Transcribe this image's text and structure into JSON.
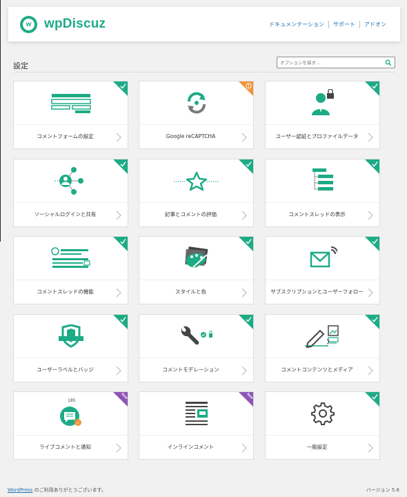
{
  "brand": {
    "name": "wpDiscuz",
    "logo_letter": "w"
  },
  "top_nav": [
    "ドキュメンテーション",
    "サポート",
    "アドオン"
  ],
  "page": {
    "title": "設定",
    "search_placeholder": "オプションを探す..."
  },
  "colors": {
    "accent": "#1dab86",
    "warning": "#f0953a",
    "new": "#8e55b5"
  },
  "cards": [
    {
      "label": "コメントフォームの設定",
      "icon": "comment-form-icon",
      "badge": "check"
    },
    {
      "label": "Google reCAPTCHA",
      "icon": "recaptcha-icon",
      "badge": "warning"
    },
    {
      "label": "ユーザー認証とプロファイルデータ",
      "icon": "user-auth-icon",
      "badge": "check"
    },
    {
      "label": "ソーシャルログインと共有",
      "icon": "social-share-icon",
      "badge": "check"
    },
    {
      "label": "記事とコメントの評価",
      "icon": "star-rating-icon",
      "badge": "check"
    },
    {
      "label": "コメントスレッドの表示",
      "icon": "thread-display-icon",
      "badge": "check"
    },
    {
      "label": "コメントスレッドの機能",
      "icon": "thread-features-icon",
      "badge": "check"
    },
    {
      "label": "スタイルと色",
      "icon": "palette-icon",
      "badge": "check"
    },
    {
      "label": "サブスクリプションとユーザーフォロー",
      "icon": "subscription-icon",
      "badge": "check"
    },
    {
      "label": "ユーザーラベルとバッジ",
      "icon": "badge-shield-icon",
      "badge": "check"
    },
    {
      "label": "コメントモデレーション",
      "icon": "moderation-wrench-icon",
      "badge": "check"
    },
    {
      "label": "コメントコンテンツとメディア",
      "icon": "content-media-icon",
      "badge": "check"
    },
    {
      "label": "ライブコメントと通知",
      "icon": "live-notification-icon",
      "badge": "new",
      "counter": "185"
    },
    {
      "label": "インラインコメント",
      "icon": "inline-comment-icon",
      "badge": "new"
    },
    {
      "label": "一般設定",
      "icon": "gear-icon",
      "badge": "check"
    }
  ],
  "badge_new_text": "New",
  "footer": {
    "link": "WordPress",
    "text": " のご利用ありがとうございます。",
    "version": "バージョン 5.8"
  }
}
